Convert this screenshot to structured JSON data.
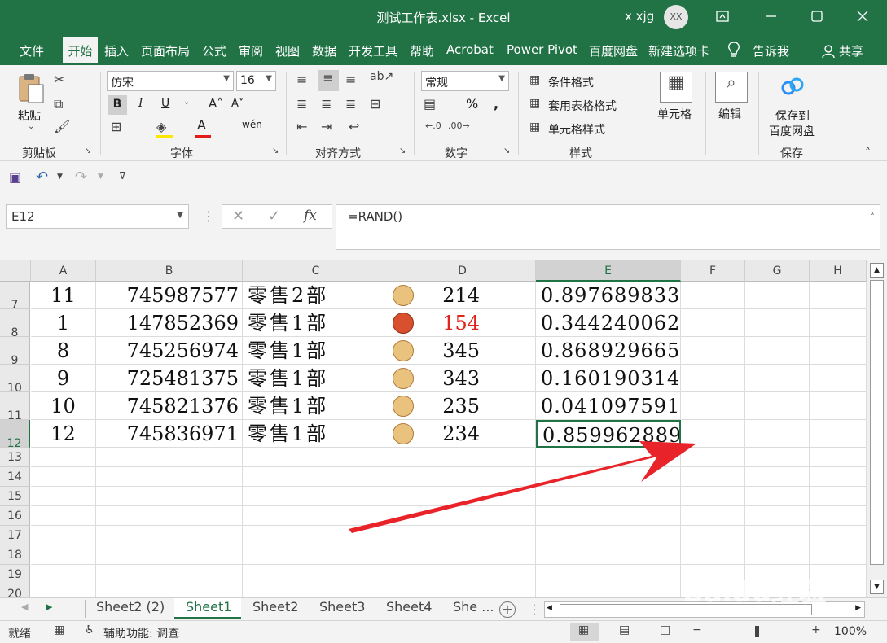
{
  "window": {
    "title": "测试工作表.xlsx  -  Excel",
    "user": "x xjg",
    "avatar_initials": "XX"
  },
  "menu": {
    "items": [
      "文件",
      "开始",
      "插入",
      "页面布局",
      "公式",
      "审阅",
      "视图",
      "数据",
      "开发工具",
      "帮助",
      "Acrobat",
      "Power Pivot",
      "百度网盘",
      "新建选项卡",
      "告诉我",
      "共享"
    ]
  },
  "ribbon": {
    "clipboard": {
      "paste": "粘贴",
      "group": "剪贴板"
    },
    "font": {
      "name": "仿宋",
      "size": "16",
      "group": "字体"
    },
    "alignment": {
      "group": "对齐方式"
    },
    "number": {
      "format": "常规",
      "percent": "%",
      "comma": ",",
      "group": "数字"
    },
    "styles": {
      "conditional": "条件格式",
      "table": "套用表格格式",
      "cell_style": "单元格样式",
      "group": "样式"
    },
    "cells": {
      "label": "单元格"
    },
    "edit": {
      "label": "编辑"
    },
    "save": {
      "label1": "保存到",
      "label2": "百度网盘",
      "group": "保存"
    }
  },
  "formula_bar": {
    "name_box": "E12",
    "formula": "=RAND()"
  },
  "columns": [
    "A",
    "B",
    "C",
    "D",
    "E",
    "F",
    "G",
    "H"
  ],
  "rows": [
    {
      "num": "7",
      "a": "11",
      "b": "745987577",
      "c": "零售2部",
      "d": "214",
      "e": "0.897689833",
      "dot": "tan",
      "red": false
    },
    {
      "num": "8",
      "a": "1",
      "b": "147852369",
      "c": "零售1部",
      "d": "154",
      "e": "0.344240062",
      "dot": "red",
      "red": true
    },
    {
      "num": "9",
      "a": "8",
      "b": "745256974",
      "c": "零售1部",
      "d": "345",
      "e": "0.868929665",
      "dot": "tan",
      "red": false
    },
    {
      "num": "10",
      "a": "9",
      "b": "725481375",
      "c": "零售1部",
      "d": "343",
      "e": "0.160190314",
      "dot": "tan",
      "red": false
    },
    {
      "num": "11",
      "a": "10",
      "b": "745821376",
      "c": "零售1部",
      "d": "235",
      "e": "0.041097591",
      "dot": "tan",
      "red": false
    },
    {
      "num": "12",
      "a": "12",
      "b": "745836971",
      "c": "零售1部",
      "d": "234",
      "e": "0.859962889",
      "dot": "tan",
      "red": false
    }
  ],
  "empty_rows": [
    "13",
    "14",
    "15",
    "16",
    "17",
    "18",
    "19",
    "20"
  ],
  "sheets": [
    "Sheet2 (2)",
    "Sheet1",
    "Sheet2",
    "Sheet3",
    "Sheet4",
    "She ..."
  ],
  "active_sheet": "Sheet1",
  "status": {
    "ready": "就绪",
    "accessibility": "辅助功能: 调查",
    "zoom": "100%"
  },
  "colors": {
    "excel_green": "#217346",
    "dot_tan": "#e9c27e",
    "dot_red": "#d9502e",
    "arrow": "#e8232a"
  },
  "watermark": {
    "brand": "Baidu经验",
    "url": "jingyan.baidu.com"
  }
}
